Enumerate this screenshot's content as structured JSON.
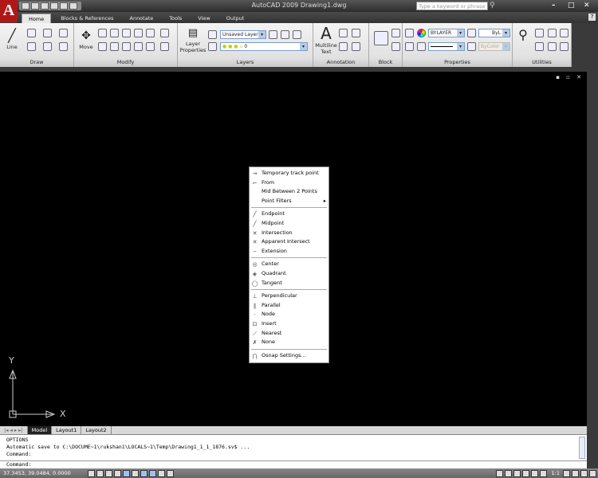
{
  "app": {
    "title": "AutoCAD 2009 Drawing1.dwg",
    "logo_letter": "A",
    "search_placeholder": "Type a keyword or phrase"
  },
  "ribbon_tabs": [
    "Home",
    "Blocks & References",
    "Annotate",
    "Tools",
    "View",
    "Output"
  ],
  "panels": {
    "draw": {
      "label": "Draw",
      "line": "Line"
    },
    "modify": {
      "label": "Modify",
      "move": "Move"
    },
    "layers": {
      "label": "Layers",
      "layer_properties": "Layer Properties",
      "layer_state": "Unsaved Layer S",
      "current_layer": "0"
    },
    "annotation": {
      "label": "Annotation",
      "multiline_text": "Multiline Text"
    },
    "block": {
      "label": "Block"
    },
    "properties": {
      "label": "Properties",
      "color": "BYLAYER",
      "lineweight": "ByL",
      "plotstyle": "ByColor"
    },
    "utilities": {
      "label": "Utilities"
    }
  },
  "axis": {
    "y": "Y",
    "x": "X"
  },
  "osnap_menu": [
    [
      {
        "label": "Temporary track point",
        "icon": "track-icon",
        "g": "→"
      },
      {
        "label": "From",
        "icon": "from-icon",
        "g": "⌐"
      },
      {
        "label": "Mid Between 2 Points",
        "icon": "",
        "g": ""
      },
      {
        "label": "Point Filters",
        "icon": "",
        "g": "",
        "submenu": true
      }
    ],
    [
      {
        "label": "Endpoint",
        "icon": "endpoint-icon",
        "g": "╱"
      },
      {
        "label": "Midpoint",
        "icon": "midpoint-icon",
        "g": "╱"
      },
      {
        "label": "Intersection",
        "icon": "intersection-icon",
        "g": "✕"
      },
      {
        "label": "Apparent Intersect",
        "icon": "apparent-intersect-icon",
        "g": "✕"
      },
      {
        "label": "Extension",
        "icon": "extension-icon",
        "g": "┄"
      }
    ],
    [
      {
        "label": "Center",
        "icon": "center-icon",
        "g": "◎"
      },
      {
        "label": "Quadrant",
        "icon": "quadrant-icon",
        "g": "◈"
      },
      {
        "label": "Tangent",
        "icon": "tangent-icon",
        "g": "◯"
      }
    ],
    [
      {
        "label": "Perpendicular",
        "icon": "perpendicular-icon",
        "g": "⊥"
      },
      {
        "label": "Parallel",
        "icon": "parallel-icon",
        "g": "∥"
      },
      {
        "label": "Node",
        "icon": "node-icon",
        "g": "·"
      },
      {
        "label": "Insert",
        "icon": "insert-icon",
        "g": "⊡"
      },
      {
        "label": "Nearest",
        "icon": "nearest-icon",
        "g": "⟋"
      },
      {
        "label": "None",
        "icon": "none-icon",
        "g": "✗"
      }
    ],
    [
      {
        "label": "Osnap Settings...",
        "icon": "osnap-settings-icon",
        "g": "⋂"
      }
    ]
  ],
  "layout_tabs": [
    "Model",
    "Layout1",
    "Layout2"
  ],
  "command_history": [
    "OPTIONS",
    "Automatic save to C:\\DOCUME~1\\rukshan1\\LOCALS~1\\Temp\\Drawing1_1_1_1876.sv$ ...",
    "Command:"
  ],
  "command_prompt": "Command:",
  "status": {
    "coordinates": "37.3453, 39.0484, 0.0000",
    "scale": "1:1"
  }
}
